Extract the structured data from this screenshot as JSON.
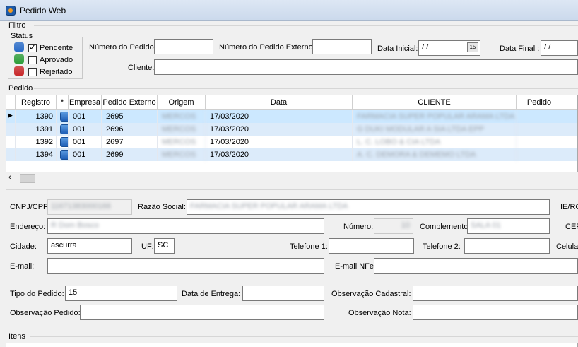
{
  "window": {
    "title": "Pedido Web"
  },
  "filtro": {
    "group_label": "Filtro",
    "status_label": "Status",
    "status": [
      {
        "label": "Pendente",
        "color": "#2a6cc8",
        "checked": true
      },
      {
        "label": "Aprovado",
        "color": "#2e9e3a",
        "checked": false
      },
      {
        "label": "Rejeitado",
        "color": "#c8282a",
        "checked": false
      }
    ],
    "numero_pedido_label": "Número do Pedido:",
    "numero_pedido_externo_label": "Número do Pedido Externo:",
    "data_inicial_label": "Data Inicial:",
    "data_inicial_value": "/ /",
    "data_final_label": "Data Final :",
    "data_final_value": "/ /",
    "cliente_label": "Cliente:"
  },
  "pedido": {
    "group_label": "Pedido",
    "columns": [
      "Registro",
      "*",
      "Empresa",
      "Pedido Externo",
      "Origem",
      "Data",
      "CLIENTE",
      "Pedido"
    ],
    "rows": [
      {
        "registro": "1390",
        "empresa": "001",
        "pedido_externo": "2695",
        "origem": "MERCOS",
        "data": "17/03/2020",
        "cliente": "FARMACIA SUPER POPULAR ARAMA LTDA",
        "selected": true
      },
      {
        "registro": "1391",
        "empresa": "001",
        "pedido_externo": "2696",
        "origem": "MERCOS",
        "data": "17/03/2020",
        "cliente": "G DUKI MODULAR A SIA LTDA EPP",
        "selected": false
      },
      {
        "registro": "1392",
        "empresa": "001",
        "pedido_externo": "2697",
        "origem": "MERCOS",
        "data": "17/03/2020",
        "cliente": "L. C. LOBO & CIA LTDA",
        "selected": false
      },
      {
        "registro": "1394",
        "empresa": "001",
        "pedido_externo": "2699",
        "origem": "MERCOS",
        "data": "17/03/2020",
        "cliente": "A. C. DEMORA & DEMEMO LTDA",
        "selected": false
      }
    ]
  },
  "detalhe": {
    "cnpj_label": "CNPJ/CPF:",
    "cnpj_value": "11671383000166",
    "razao_label": "Razão Social:",
    "razao_value": "FARMACIA SUPER POPULAR ARAMA LTDA",
    "ie_label": "IE/RG",
    "endereco_label": "Endereço:",
    "endereco_value": "R Dom Bosco",
    "numero_label": "Número:",
    "numero_value": "10",
    "complemento_label": "Complemento:",
    "complemento_value": "SALA 01",
    "cep_label": "CEP",
    "cidade_label": "Cidade:",
    "cidade_value": "ascurra",
    "uf_label": "UF:",
    "uf_value": "SC",
    "telefone1_label": "Telefone 1:",
    "telefone2_label": "Telefone 2:",
    "celular_label": "Celular",
    "email_label": "E-mail:",
    "email_nfe_label": "E-mail NFe:",
    "tipo_pedido_label": "Tipo do Pedido:",
    "tipo_pedido_value": "15",
    "data_entrega_label": "Data de Entrega:",
    "obs_cadastral_label": "Observação Cadastral:",
    "obs_pedido_label": "Observação Pedido:",
    "obs_nota_label": "Observação Nota:"
  },
  "itens": {
    "group_label": "Itens"
  }
}
